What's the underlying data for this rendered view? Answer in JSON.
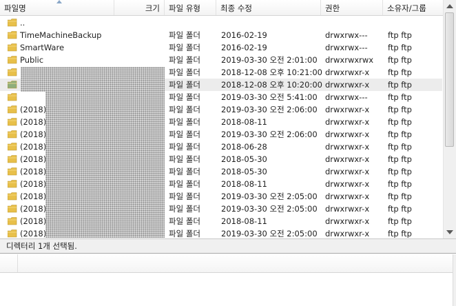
{
  "columns": {
    "name": "파일명",
    "size": "크기",
    "type": "파일 유형",
    "modified": "최종 수정",
    "permissions": "권한",
    "owner": "소유자/그룹"
  },
  "rows": [
    {
      "name": "..",
      "type": "",
      "modified": "",
      "permissions": "",
      "owner": ""
    },
    {
      "name": "TimeMachineBackup",
      "type": "파일 폴더",
      "modified": "2016-02-19",
      "permissions": "drwxrwx---",
      "owner": "ftp ftp"
    },
    {
      "name": "SmartWare",
      "type": "파일 폴더",
      "modified": "2016-02-19",
      "permissions": "drwxrwx---",
      "owner": "ftp ftp"
    },
    {
      "name": "Public",
      "type": "파일 폴더",
      "modified": "2019-03-30 오전 2:01:00",
      "permissions": "drwxrwxrwx",
      "owner": "ftp ftp"
    },
    {
      "name": "",
      "type": "파일 폴더",
      "modified": "2018-12-08 오후 10:21:00",
      "permissions": "drwxrwxr-x",
      "owner": "ftp ftp"
    },
    {
      "name": "",
      "type": "파일 폴더",
      "modified": "2018-12-08 오후 10:20:00",
      "permissions": "drwxrwxr-x",
      "owner": "ftp ftp",
      "selected": true
    },
    {
      "name": "",
      "type": "파일 폴더",
      "modified": "2019-03-30 오전 5:41:00",
      "permissions": "drwxrwx---",
      "owner": "ftp ftp"
    },
    {
      "name": "(2018)",
      "type": "파일 폴더",
      "modified": "2019-03-30 오전 2:06:00",
      "permissions": "drwxrwxr-x",
      "owner": "ftp ftp"
    },
    {
      "name": "(2018)",
      "type": "파일 폴더",
      "modified": "2018-08-11",
      "permissions": "drwxrwxr-x",
      "owner": "ftp ftp"
    },
    {
      "name": "(2018)",
      "type": "파일 폴더",
      "modified": "2019-03-30 오전 2:06:00",
      "permissions": "drwxrwxr-x",
      "owner": "ftp ftp"
    },
    {
      "name": "(2018)",
      "type": "파일 폴더",
      "modified": "2018-06-28",
      "permissions": "drwxrwxr-x",
      "owner": "ftp ftp"
    },
    {
      "name": "(2018)",
      "type": "파일 폴더",
      "modified": "2018-05-30",
      "permissions": "drwxrwxr-x",
      "owner": "ftp ftp"
    },
    {
      "name": "(2018)",
      "type": "파일 폴더",
      "modified": "2018-05-30",
      "permissions": "drwxrwxr-x",
      "owner": "ftp ftp"
    },
    {
      "name": "(2018)",
      "type": "파일 폴더",
      "modified": "2018-08-11",
      "permissions": "drwxrwxr-x",
      "owner": "ftp ftp"
    },
    {
      "name": "(2018)",
      "type": "파일 폴더",
      "modified": "2019-03-30 오전 2:05:00",
      "permissions": "drwxrwxr-x",
      "owner": "ftp ftp"
    },
    {
      "name": "(2018)",
      "type": "파일 폴더",
      "modified": "2019-03-30 오전 2:05:00",
      "permissions": "drwxrwxr-x",
      "owner": "ftp ftp"
    },
    {
      "name": "(2018)",
      "type": "파일 폴더",
      "modified": "2018-08-11",
      "permissions": "drwxrwxr-x",
      "owner": "ftp ftp"
    },
    {
      "name": "(2018)",
      "type": "파일 폴더",
      "modified": "2019-03-30 오전 2:05:00",
      "permissions": "drwxrwxr-x",
      "owner": "ftp ftp"
    }
  ],
  "status": {
    "text": "디렉터리 1개 선택됨."
  },
  "icons": {
    "folder": "folder-icon",
    "sort": "sort-arrow-icon",
    "scroll_up": "scroll-up-arrow-icon",
    "scroll_down": "scroll-down-arrow-icon"
  },
  "colors": {
    "folder_yellow": "#e8c04a",
    "folder_green": "#8fae7a",
    "selection_bg": "#ececec"
  }
}
